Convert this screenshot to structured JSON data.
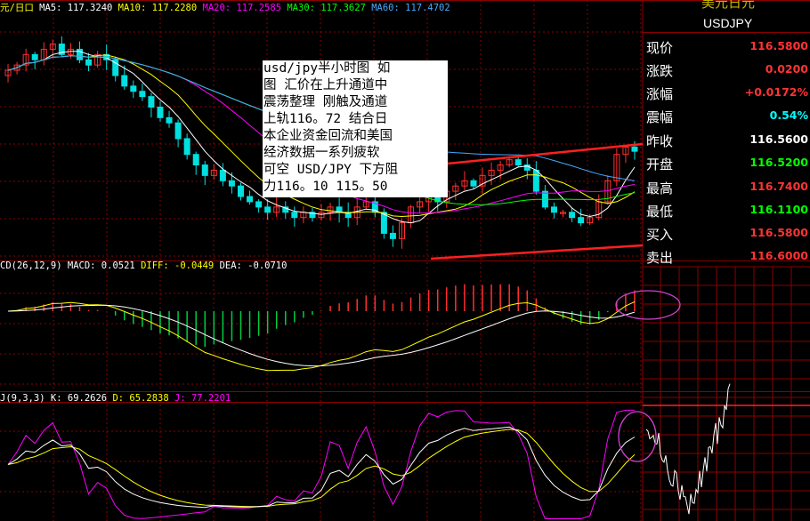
{
  "symbol": {
    "title": "美元日元",
    "code": "USDJPY"
  },
  "main_panel": {
    "title": "元/日口",
    "ma": [
      {
        "label": "MA5: 117.3240",
        "color": "#ffffff"
      },
      {
        "label": "MA10: 117.2280",
        "color": "#ffff00"
      },
      {
        "label": "MA20: 117.2585",
        "color": "#ff00ff"
      },
      {
        "label": "MA30: 117.3627",
        "color": "#00ff00"
      },
      {
        "label": "MA60: 117.4702",
        "color": "#44aaff"
      }
    ]
  },
  "macd_panel": {
    "name": "CD(26,12,9)",
    "values": [
      {
        "label": "MACD: 0.0521",
        "color": "#ffffff"
      },
      {
        "label": "DIFF: -0.0449",
        "color": "#ffff00"
      },
      {
        "label": "DEA: -0.0710",
        "color": "#ffffff"
      }
    ]
  },
  "kdj_panel": {
    "name": "J(9,3,3)",
    "values": [
      {
        "label": "K: 69.2626",
        "color": "#ffffff"
      },
      {
        "label": "D: 65.2838",
        "color": "#ffff00"
      },
      {
        "label": "J: 77.2201",
        "color": "#ff00ff"
      }
    ]
  },
  "annotation": {
    "lines": [
      "usd/jpy半小时图  如",
      "图 汇价在上升通道中",
      "震荡整理 刚触及通道",
      "上轨116。72  结合日",
      "本企业资金回流和美国",
      "经济数据一系列疲软",
      "可空 USD/JPY  下方阻",
      "力116。10 115。50"
    ]
  },
  "quotes": [
    {
      "label": "现价",
      "value": "116.5800",
      "color": "#ff3333"
    },
    {
      "label": "涨跌",
      "value": "0.0200",
      "color": "#ff3333"
    },
    {
      "label": "涨幅",
      "value": "+0.0172%",
      "color": "#ff3333"
    },
    {
      "label": "震幅",
      "value": "0.54%",
      "color": "#00ffff"
    },
    {
      "label": "昨收",
      "value": "116.5600",
      "color": "#ffffff"
    },
    {
      "label": "开盘",
      "value": "116.5200",
      "color": "#00ff00"
    },
    {
      "label": "最高",
      "value": "116.7400",
      "color": "#ff3333"
    },
    {
      "label": "最低",
      "value": "116.1100",
      "color": "#00ff00"
    },
    {
      "label": "买入",
      "value": "116.5800",
      "color": "#ff3333"
    },
    {
      "label": "卖出",
      "value": "116.6000",
      "color": "#ff3333"
    }
  ],
  "colors": {
    "background": "#000000",
    "grid": "#8b0000",
    "up_candle": "#ff3030",
    "down_candle": "#00e0e0",
    "channel": "#ff2020",
    "highlight_ellipse": "#cc44cc",
    "tick_line": "#ffffff"
  },
  "chart_data": [
    {
      "type": "candlestick",
      "title": "usd/jpy半小时图",
      "ma_periods": [
        5,
        10,
        20,
        30,
        60
      ],
      "channel": {
        "upper_end": 116.72
      },
      "support_levels": [
        116.1,
        115.5
      ],
      "close_series": [
        117.35,
        117.4,
        117.5,
        117.45,
        117.55,
        117.6,
        117.5,
        117.55,
        117.45,
        117.4,
        117.5,
        117.45,
        117.3,
        117.2,
        117.15,
        117.1,
        117.0,
        116.9,
        116.85,
        116.7,
        116.55,
        116.45,
        116.35,
        116.4,
        116.3,
        116.25,
        116.15,
        116.1,
        116.05,
        116.0,
        116.05,
        116.0,
        115.95,
        116.0,
        115.95,
        116.0,
        116.05,
        116.0,
        115.95,
        116.05,
        116.1,
        116.0,
        115.8,
        115.75,
        115.9,
        116.05,
        116.1,
        116.15,
        116.1,
        116.2,
        116.25,
        116.3,
        116.25,
        116.35,
        116.4,
        116.45,
        116.5,
        116.45,
        116.4,
        116.2,
        116.05,
        116.0,
        116.0,
        115.95,
        115.9,
        115.95,
        116.1,
        116.3,
        116.55,
        116.62,
        116.58
      ]
    },
    {
      "type": "bar",
      "name": "MACD",
      "params": [
        26,
        12,
        9
      ],
      "series": [
        {
          "name": "MACD",
          "last": 0.0521
        },
        {
          "name": "DIFF",
          "last": -0.0449
        },
        {
          "name": "DEA",
          "last": -0.071
        }
      ]
    },
    {
      "type": "line",
      "name": "KDJ",
      "params": [
        9,
        3,
        3
      ],
      "series": [
        {
          "name": "K",
          "last": 69.2626
        },
        {
          "name": "D",
          "last": 65.2838
        },
        {
          "name": "J",
          "last": 77.2201
        }
      ]
    }
  ]
}
